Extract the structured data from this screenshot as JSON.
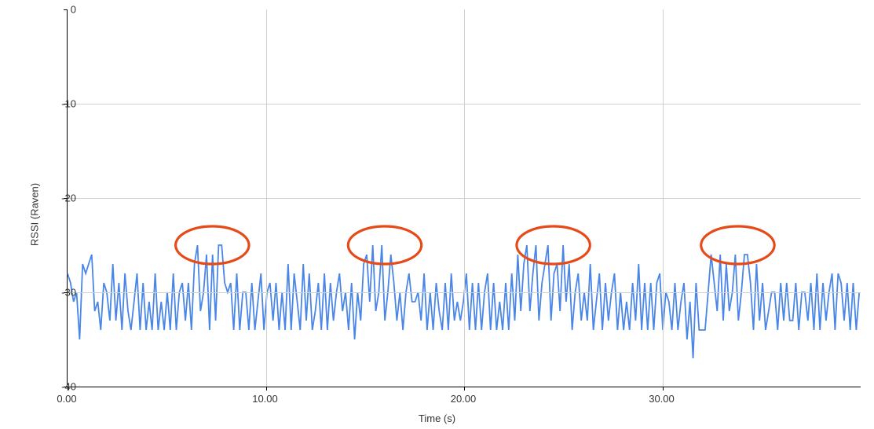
{
  "chart_data": {
    "type": "line",
    "xlabel": "Time (s)",
    "ylabel": "RSSI (Raven)",
    "xlim": [
      0,
      40
    ],
    "ylim": [
      -40,
      0
    ],
    "xticks": [
      0.0,
      10.0,
      20.0,
      30.0
    ],
    "yticks": [
      0,
      -10,
      -20,
      -30,
      -40
    ],
    "grid": true,
    "series": [
      {
        "name": "RSSI",
        "color": "#4a86e8",
        "x_step": 0.1524,
        "values": [
          -28,
          -29,
          -31,
          -30,
          -35,
          -27,
          -28,
          -27,
          -26,
          -32,
          -31,
          -34,
          -29,
          -30,
          -33,
          -27,
          -33,
          -29,
          -34,
          -28,
          -32,
          -34,
          -31,
          -28,
          -34,
          -29,
          -34,
          -31,
          -34,
          -28,
          -34,
          -31,
          -34,
          -30,
          -34,
          -28,
          -34,
          -30,
          -29,
          -33,
          -29,
          -34,
          -27,
          -25,
          -32,
          -30,
          -26,
          -34,
          -26,
          -33,
          -25,
          -25,
          -29,
          -30,
          -29,
          -34,
          -28,
          -34,
          -30,
          -30,
          -34,
          -29,
          -34,
          -31,
          -28,
          -34,
          -30,
          -29,
          -33,
          -29,
          -34,
          -30,
          -34,
          -27,
          -34,
          -28,
          -31,
          -34,
          -27,
          -33,
          -28,
          -34,
          -32,
          -29,
          -34,
          -28,
          -34,
          -29,
          -33,
          -30,
          -28,
          -32,
          -30,
          -34,
          -29,
          -35,
          -30,
          -33,
          -27,
          -26,
          -31,
          -25,
          -32,
          -30,
          -25,
          -33,
          -30,
          -26,
          -29,
          -33,
          -30,
          -34,
          -30,
          -28,
          -31,
          -31,
          -30,
          -33,
          -28,
          -34,
          -30,
          -34,
          -29,
          -32,
          -34,
          -29,
          -34,
          -28,
          -33,
          -31,
          -33,
          -31,
          -28,
          -34,
          -29,
          -34,
          -29,
          -34,
          -30,
          -28,
          -34,
          -29,
          -34,
          -31,
          -34,
          -29,
          -34,
          -28,
          -33,
          -26,
          -32,
          -27,
          -25,
          -32,
          -28,
          -25,
          -33,
          -29,
          -27,
          -25,
          -33,
          -28,
          -27,
          -32,
          -25,
          -31,
          -27,
          -34,
          -30,
          -28,
          -33,
          -30,
          -33,
          -27,
          -34,
          -31,
          -28,
          -34,
          -29,
          -33,
          -30,
          -28,
          -34,
          -30,
          -34,
          -31,
          -34,
          -29,
          -33,
          -27,
          -34,
          -29,
          -34,
          -29,
          -34,
          -29,
          -28,
          -34,
          -30,
          -31,
          -34,
          -29,
          -34,
          -31,
          -29,
          -35,
          -31,
          -37,
          -29,
          -34,
          -34,
          -34,
          -30,
          -26,
          -29,
          -32,
          -26,
          -33,
          -27,
          -32,
          -30,
          -26,
          -33,
          -30,
          -26,
          -26,
          -29,
          -34,
          -27,
          -33,
          -29,
          -34,
          -32,
          -30,
          -30,
          -34,
          -29,
          -33,
          -29,
          -33,
          -33,
          -29,
          -34,
          -30,
          -30,
          -33,
          -29,
          -34,
          -28,
          -34,
          -29,
          -33,
          -30,
          -28,
          -34,
          -28,
          -29,
          -33,
          -29,
          -34,
          -29,
          -34,
          -30
        ]
      }
    ],
    "annotations": [
      {
        "kind": "ellipse",
        "cx": 7.3,
        "cy": -25,
        "rx": 1.85,
        "ry": 2.0
      },
      {
        "kind": "ellipse",
        "cx": 16.0,
        "cy": -25,
        "rx": 1.85,
        "ry": 2.0
      },
      {
        "kind": "ellipse",
        "cx": 24.5,
        "cy": -25,
        "rx": 1.85,
        "ry": 2.0
      },
      {
        "kind": "ellipse",
        "cx": 33.8,
        "cy": -25,
        "rx": 1.85,
        "ry": 2.0
      }
    ],
    "xtick_labels": [
      "0.00",
      "10.00",
      "20.00",
      "30.00"
    ],
    "ytick_labels": [
      "0",
      "-10",
      "-20",
      "-30",
      "-40"
    ]
  }
}
